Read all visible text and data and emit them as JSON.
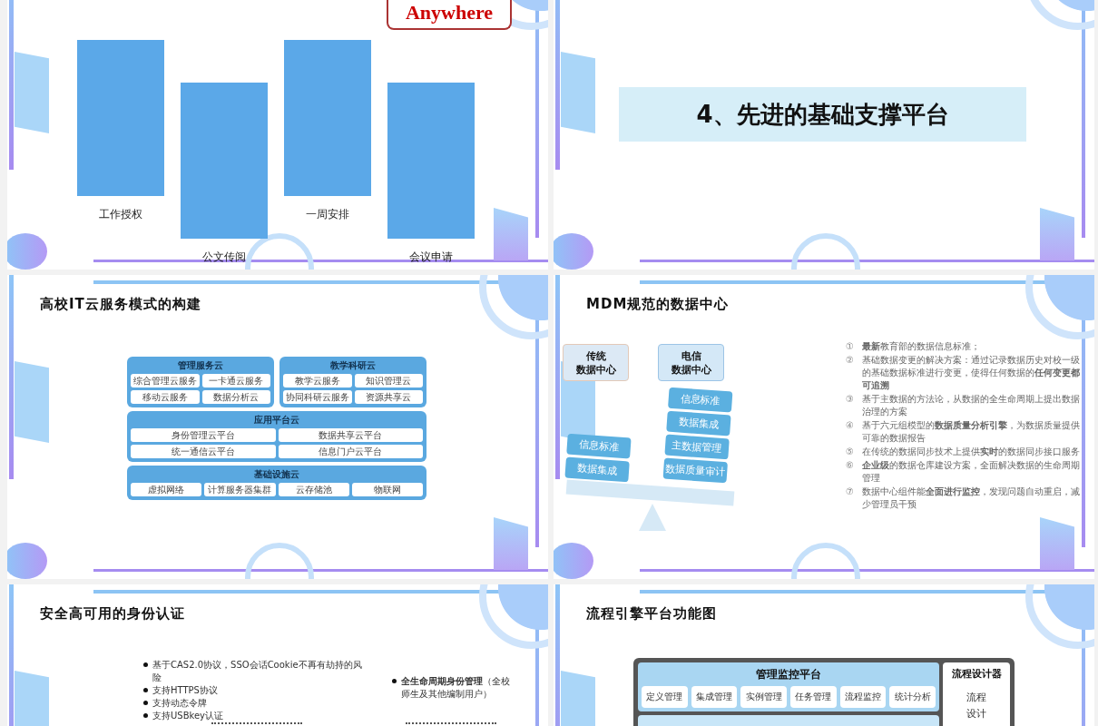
{
  "slides": [
    {
      "kind": "bars",
      "logo": "Anywhere",
      "items": [
        {
          "label": "工作授权"
        },
        {
          "label": "公文传阅"
        },
        {
          "label": "一周安排"
        },
        {
          "label": "会议申请"
        }
      ]
    },
    {
      "kind": "section",
      "heading": "4、先进的基础支撑平台"
    },
    {
      "kind": "cloud",
      "title": "高校IT云服务模式的构建",
      "groups": [
        {
          "title": "管理服务云",
          "items": [
            "综合管理云服务",
            "一卡通云服务",
            "移动云服务",
            "数据分析云"
          ]
        },
        {
          "title": "教学科研云",
          "items": [
            "教学云服务",
            "知识管理云",
            "协同科研云服务",
            "资源共享云"
          ]
        }
      ],
      "platform": {
        "title": "应用平台云",
        "items": [
          "身份管理云平台",
          "数据共享云平台",
          "统一通信云平台",
          "信息门户云平台"
        ]
      },
      "infra": {
        "title": "基础设施云",
        "items": [
          "虚拟网络",
          "计算服务器集群",
          "云存储池",
          "物联网"
        ]
      }
    },
    {
      "kind": "mdm",
      "title": "MDM规范的数据中心",
      "centers": [
        {
          "lines": [
            "传统",
            "数据中心"
          ]
        },
        {
          "lines": [
            "电信",
            "数据中心"
          ]
        }
      ],
      "left_pan": [
        "信息标准",
        "数据集成"
      ],
      "right_pan": [
        "信息标准",
        "数据集成",
        "主数据管理",
        "数据质量审计"
      ],
      "points": [
        {
          "number": "①",
          "text": "**最新**教育部的数据信息标准；"
        },
        {
          "number": "②",
          "text": "基础数据变更的解决方案：通过记录数据历史对校一级的基础数据标准进行变更，使得任何数据的**任何变更都可追溯**"
        },
        {
          "number": "③",
          "text": "基于主数据的方法论，从数据的全生命周期上提出数据治理的方案"
        },
        {
          "number": "④",
          "text": "基于六元组模型的**数据质量分析引擎**，为数据质量提供可靠的数据报告"
        },
        {
          "number": "⑤",
          "text": "在传统的数据同步技术上提供**实时**的数据同步接口服务"
        },
        {
          "number": "⑥",
          "text": "**企业级**的数据仓库建设方案，全面解决数据的生命周期管理"
        },
        {
          "number": "⑦",
          "text": "数据中心组件能**全面进行监控**，发现问题自动重启，减少管理员干预"
        }
      ]
    },
    {
      "kind": "identity",
      "title": "安全高可用的身份认证",
      "left_bullets": [
        "基于CAS2.0协议，SSO会话Cookie不再有劫持的风险",
        "支持HTTPS协议",
        "支持动态令牌",
        "支持USBkey认证"
      ],
      "right_bullets": [
        "**全生命周期身份管理**（全校师生及其他编制用户）"
      ]
    },
    {
      "kind": "flow",
      "title": "流程引擎平台功能图",
      "panel": {
        "title": "管理监控平台",
        "items": [
          "定义管理",
          "集成管理",
          "实例管理",
          "任务管理",
          "流程监控",
          "统计分析"
        ]
      },
      "designer": {
        "title": "流程设计器",
        "lines": [
          "流程",
          "设计"
        ]
      }
    }
  ]
}
